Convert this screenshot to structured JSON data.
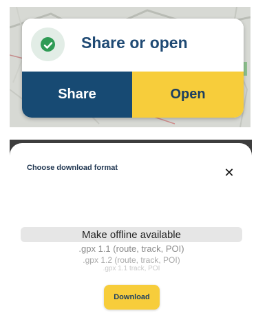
{
  "share_dialog": {
    "title": "Share or open",
    "share_label": "Share",
    "open_label": "Open",
    "check_icon": "check-circle-icon",
    "colors": {
      "title": "#1f4a74",
      "share_bg": "#174a73",
      "open_bg": "#f7cd3b",
      "check": "#2f9b55"
    }
  },
  "download_sheet": {
    "title": "Choose download format",
    "close_icon": "close-icon",
    "options": [
      "Make offline available",
      ".gpx 1.1 (route, track, POI)",
      ".gpx 1.2 (route, track, POI)",
      ".gpx 1.1 track, POI"
    ],
    "selected_option": "Make offline available",
    "download_label": "Download"
  }
}
